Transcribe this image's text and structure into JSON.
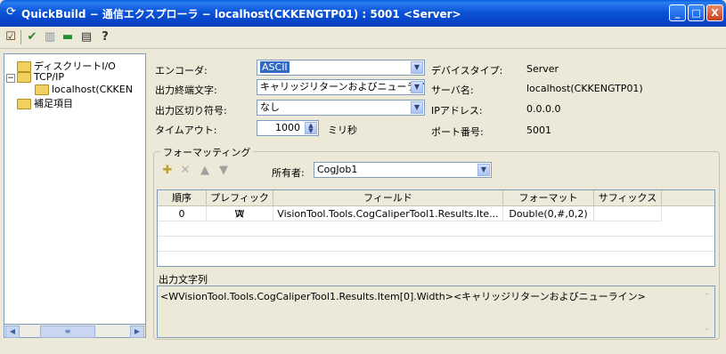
{
  "window": {
    "title": "QuickBuild − 通信エクスプローラ − localhost(CKKENGTP01) : 5001 <Server>",
    "minimize": "_",
    "maximize": "□",
    "close": "X"
  },
  "tree": {
    "items": [
      {
        "label": "ディスクリートI/O"
      },
      {
        "label": "TCP/IP"
      },
      {
        "label": "localhost(CKKEN"
      },
      {
        "label": "補足項目"
      }
    ]
  },
  "form": {
    "encoder_label": "エンコーダ:",
    "encoder_value": "ASCII",
    "terminator_label": "出力終端文字:",
    "terminator_value": "キャリッジリターンおよびニューライン",
    "delimiter_label": "出力区切り符号:",
    "delimiter_value": "なし",
    "timeout_label": "タイムアウト:",
    "timeout_value": "1000",
    "timeout_unit": "ミリ秒",
    "device_type_label": "デバイスタイプ:",
    "device_type_value": "Server",
    "server_name_label": "サーバ名:",
    "server_name_value": "localhost(CKKENGTP01)",
    "ip_label": "IPアドレス:",
    "ip_value": "0.0.0.0",
    "port_label": "ポート番号:",
    "port_value": "5001"
  },
  "formatting": {
    "title": "フォーマッティング",
    "owner_label": "所有者:",
    "owner_value": "CogJob1",
    "columns": [
      "順序",
      "プレフィックス",
      "フィールド",
      "フォーマット",
      "サフィックス"
    ],
    "rows": [
      [
        "0",
        "W",
        "VisionTool.Tools.CogCaliperTool1.Results.Ite...",
        "Double(0,#,0,2)",
        ""
      ]
    ],
    "output_label": "出力文字列",
    "output_value": "<WVisionTool.Tools.CogCaliperTool1.Results.Item[0].Width><キャリッジリターンおよびニューライン>"
  }
}
